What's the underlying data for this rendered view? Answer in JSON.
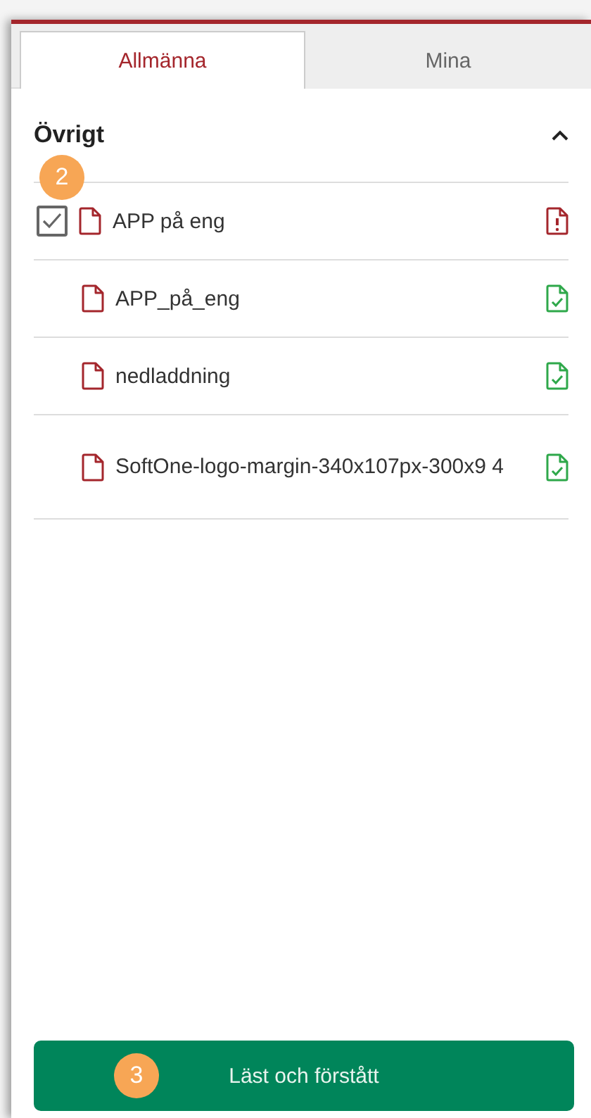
{
  "tabs": [
    {
      "label": "Allmänna",
      "selected": true
    },
    {
      "label": "Mina",
      "selected": false
    }
  ],
  "section": {
    "title": "Övrigt",
    "expanded": true,
    "items": [
      {
        "kind": "checkbox",
        "checked": true,
        "name": "APP på eng",
        "valid": false,
        "marker": "2"
      },
      {
        "kind": "plain",
        "name": "APP_på_eng",
        "valid": true
      },
      {
        "kind": "plain",
        "name": "nedladdning",
        "valid": true
      },
      {
        "kind": "plain",
        "name": "SoftOne-logo-margin-340x107px-300x9 4",
        "valid": true
      }
    ]
  },
  "button": {
    "label": "Läst och förstått",
    "marker": "3"
  }
}
